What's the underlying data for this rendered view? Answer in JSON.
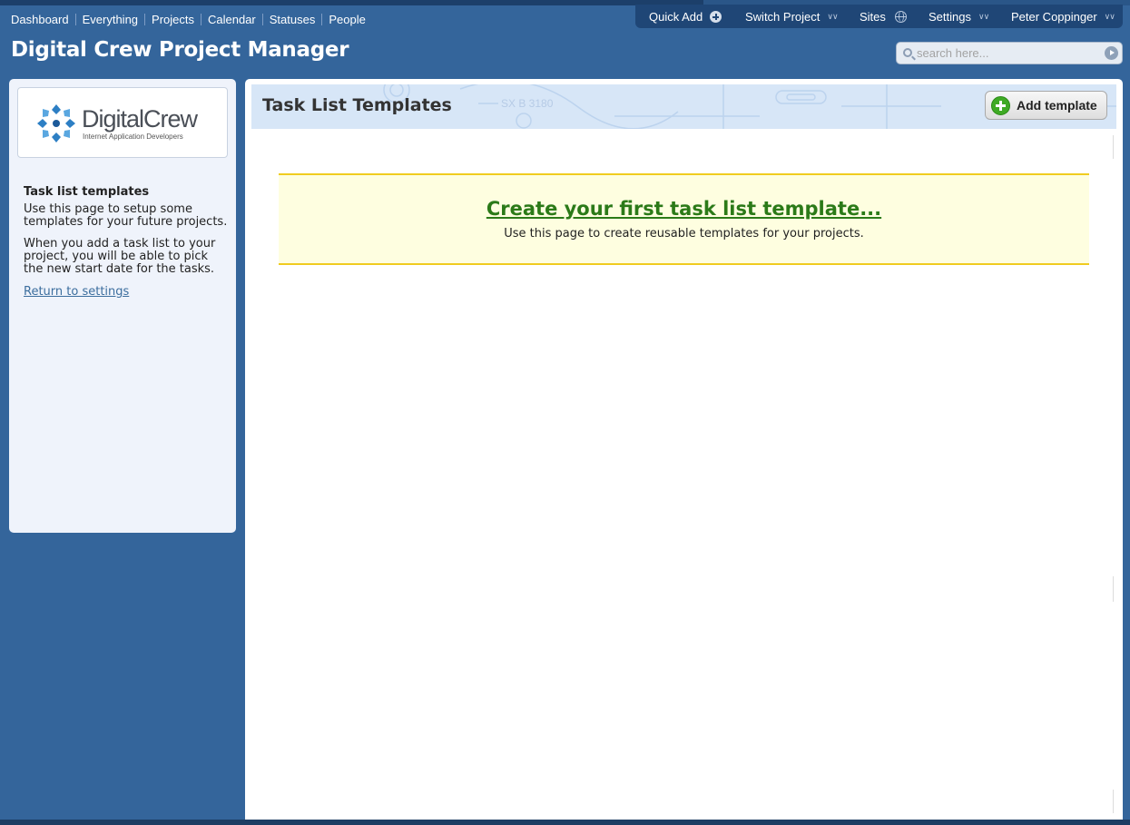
{
  "topnav": {
    "items": [
      {
        "label": "Dashboard"
      },
      {
        "label": "Everything"
      },
      {
        "label": "Projects"
      },
      {
        "label": "Calendar"
      },
      {
        "label": "Statuses"
      },
      {
        "label": "People"
      }
    ]
  },
  "userbar": {
    "quick_add": "Quick Add",
    "switch_project": "Switch Project",
    "sites": "Sites",
    "settings": "Settings",
    "user_name": "Peter Coppinger",
    "icons": {
      "quick_add": "plus-circle-icon",
      "switch_project": "chevron-down-icon",
      "sites": "globe-icon",
      "settings": "chevron-down-icon",
      "user": "chevron-down-icon"
    }
  },
  "app": {
    "title": "Digital Crew Project Manager"
  },
  "search": {
    "placeholder": "search here..."
  },
  "sidebar": {
    "logo_word": "DigitalCrew",
    "logo_sub": "Internet Application Developers",
    "heading": "Task list templates",
    "paragraph1": "Use this page to setup some templates for your future projects.",
    "paragraph2": "When you add a task list to your project, you will be able to pick the new start date for the tasks.",
    "return_link": "Return to settings"
  },
  "main": {
    "title": "Task List Templates",
    "add_button": "Add template",
    "header_decor_text": "SX B 3180",
    "notice_link": "Create your first task list template...",
    "notice_text": "Use this page to create reusable templates for your projects."
  },
  "colors": {
    "page_bg": "#34659b",
    "userbar_bg": "#1f4676",
    "link_green": "#2b7a18",
    "notice_bg": "#fefee0",
    "notice_border": "#f0cc20",
    "add_green": "#3faa24"
  }
}
